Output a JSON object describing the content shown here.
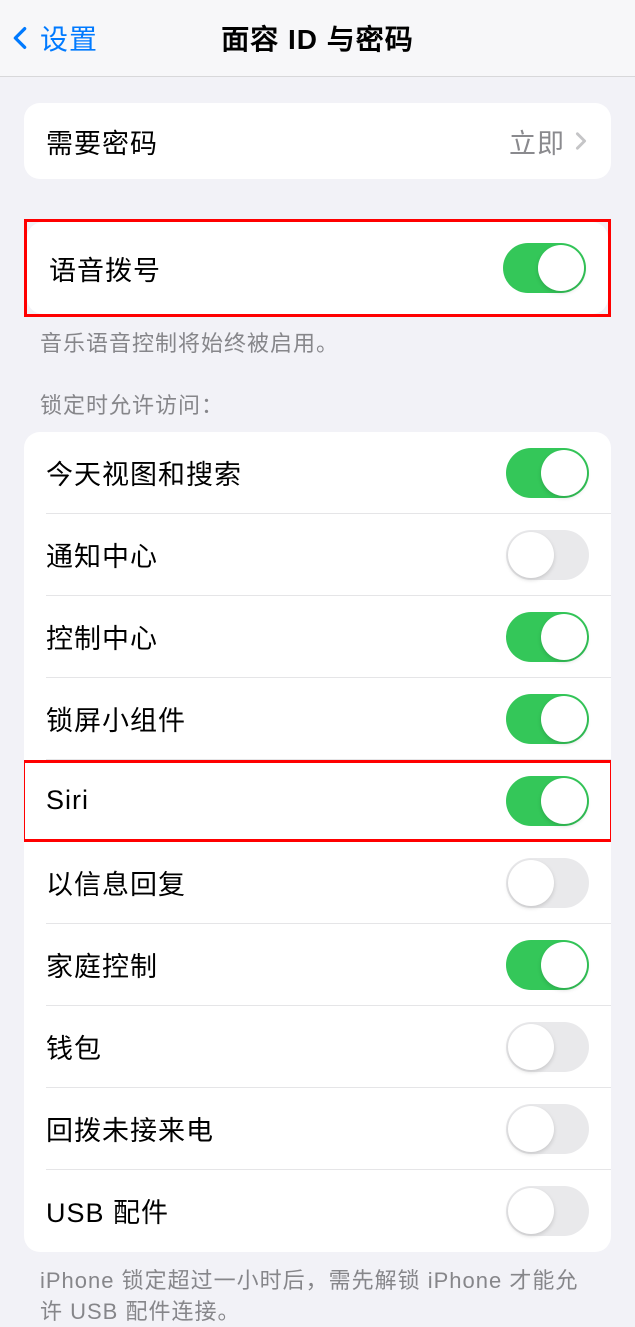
{
  "nav": {
    "back_label": "设置",
    "title": "面容 ID 与密码"
  },
  "passcode": {
    "label": "需要密码",
    "value": "立即"
  },
  "voice_dial": {
    "label": "语音拨号",
    "footer": "音乐语音控制将始终被启用。"
  },
  "lock_access": {
    "header": "锁定时允许访问：",
    "items": [
      {
        "label": "今天视图和搜索",
        "on": true
      },
      {
        "label": "通知中心",
        "on": false
      },
      {
        "label": "控制中心",
        "on": true
      },
      {
        "label": "锁屏小组件",
        "on": true
      },
      {
        "label": "Siri",
        "on": true
      },
      {
        "label": "以信息回复",
        "on": false
      },
      {
        "label": "家庭控制",
        "on": true
      },
      {
        "label": "钱包",
        "on": false
      },
      {
        "label": "回拨未接来电",
        "on": false
      },
      {
        "label": "USB 配件",
        "on": false
      }
    ],
    "footer": "iPhone 锁定超过一小时后，需先解锁 iPhone 才能允许 USB 配件连接。"
  }
}
